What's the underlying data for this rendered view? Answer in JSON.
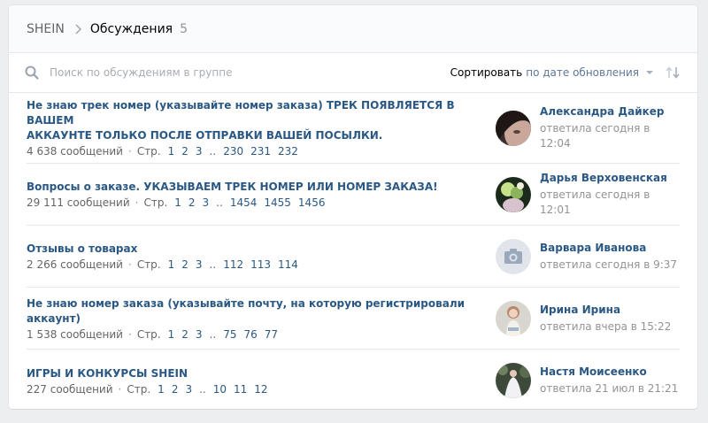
{
  "breadcrumb": {
    "group": "SHEIN",
    "section": "Обсуждения",
    "count": "5"
  },
  "search": {
    "placeholder": "Поиск по обсуждениям в группе",
    "value": ""
  },
  "sort": {
    "label": "Сортировать",
    "value": "по дате обновления"
  },
  "pages_label": "Стр.",
  "topics": [
    {
      "title": "Не знаю трек номер (указывайте номер заказа) ТРЕК ПОЯВЛЯЕТСЯ В ВАШЕМ АККАУНТЕ ТОЛЬКО ПОСЛЕ ОТПРАВКИ ВАШЕЙ ПОСЫЛКИ.",
      "title_line1": "Не знаю трек номер (указывайте номер заказа) ТРЕК ПОЯВЛЯЕТСЯ В ВАШЕМ",
      "title_line2": "АККАУНТЕ ТОЛЬКО ПОСЛЕ ОТПРАВКИ ВАШЕЙ ПОСЫЛКИ.",
      "messages": "4 638 сообщений",
      "pages": [
        "1",
        "2",
        "3",
        "..",
        "230",
        "231",
        "232"
      ],
      "last_author": "Александра Дайкер",
      "last_time": "ответила сегодня в 12:04",
      "avatar": "photo-dark"
    },
    {
      "title": "Вопросы о заказе. УКАЗЫВАЕМ ТРЕК НОМЕР ИЛИ НОМЕР ЗАКАЗА!",
      "messages": "29 111 сообщений",
      "pages": [
        "1",
        "2",
        "3",
        "..",
        "1454",
        "1455",
        "1456"
      ],
      "last_author": "Дарья Верховенская",
      "last_time": "ответила сегодня в 12:01",
      "avatar": "photo-green"
    },
    {
      "title": "Отзывы о товарах",
      "messages": "2 266 сообщений",
      "pages": [
        "1",
        "2",
        "3",
        "..",
        "112",
        "113",
        "114"
      ],
      "last_author": "Варвара Иванова",
      "last_time": "ответила сегодня в 9:37",
      "avatar": "camera-placeholder"
    },
    {
      "title": "Не знаю номер заказа (указывайте почту, на которую регистрировали аккаунт)",
      "messages": "1 538 сообщений",
      "pages": [
        "1",
        "2",
        "3",
        "..",
        "75",
        "76",
        "77"
      ],
      "last_author": "Ирина Ирина",
      "last_time": "ответила вчера в 15:22",
      "avatar": "photo-doll"
    },
    {
      "title": "ИГРЫ И КОНКУРСЫ SHEIN",
      "messages": "227 сообщений",
      "pages": [
        "1",
        "2",
        "3",
        "..",
        "10",
        "11",
        "12"
      ],
      "last_author": "Настя Моисеенко",
      "last_time": "ответила 21 июл в 21:21",
      "avatar": "photo-dress"
    }
  ],
  "colors": {
    "link": "#2a5885",
    "muted": "#939393",
    "background": "#edeef0"
  }
}
